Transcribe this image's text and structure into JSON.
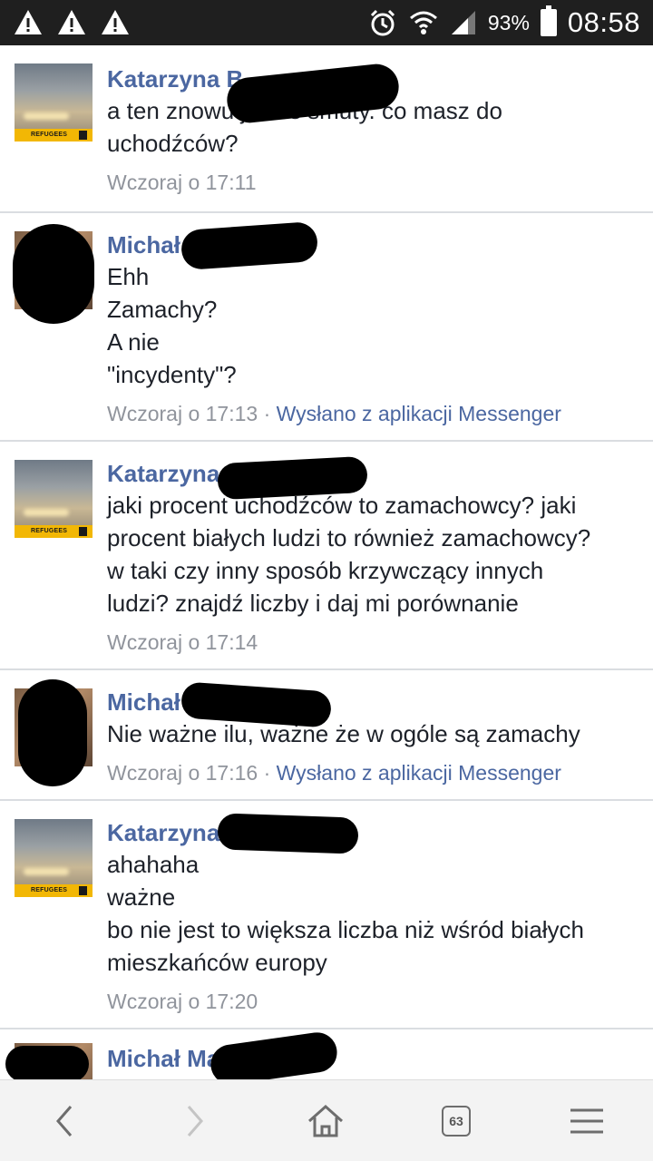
{
  "status_bar": {
    "battery_percent": "93%",
    "time": "08:58",
    "icons": [
      "warning-icon",
      "warning-icon",
      "warning-icon",
      "alarm-icon",
      "wifi-icon",
      "signal-icon",
      "battery-icon"
    ]
  },
  "comments": [
    {
      "name": "Katarzyna B",
      "lines": [
        "a ten znowu jakieś smuty. co masz do",
        "uchodźców?"
      ],
      "time": "Wczoraj o 17:11",
      "via": ""
    },
    {
      "name": "Michał",
      "lines": [
        "Ehh",
        "Zamachy?",
        "A nie",
        "\"incydenty\"?"
      ],
      "time": "Wczoraj o 17:13",
      "via": "Wysłano z aplikacji Messenger"
    },
    {
      "name": "Katarzyna",
      "lines": [
        "jaki procent uchodźców to zamachowcy? jaki",
        "procent białych ludzi to również zamachowcy?",
        "w taki czy inny sposób krzywczący innych",
        "ludzi? znajdź liczby i daj mi porównanie"
      ],
      "time": "Wczoraj o 17:14",
      "via": ""
    },
    {
      "name": "Michał",
      "lines": [
        "Nie ważne ilu, ważne że w ogóle są zamachy"
      ],
      "time": "Wczoraj o 17:16",
      "via": "Wysłano z aplikacji Messenger"
    },
    {
      "name": "Katarzyna",
      "lines": [
        "ahahaha",
        "ważne",
        "bo nie jest to większa liczba niż wśród białych",
        "mieszkańców europy"
      ],
      "time": "Wczoraj o 17:20",
      "via": ""
    },
    {
      "name": "Michał Ma",
      "lines": [],
      "time": "",
      "via": ""
    }
  ],
  "avatar_caption": "REFUGEES",
  "separator": "·",
  "bottom_nav": {
    "tab_count": "63"
  },
  "colors": {
    "name_link": "#4b67a1",
    "meta_gray": "#90949c",
    "status_bar_bg": "#1f1f1f"
  }
}
